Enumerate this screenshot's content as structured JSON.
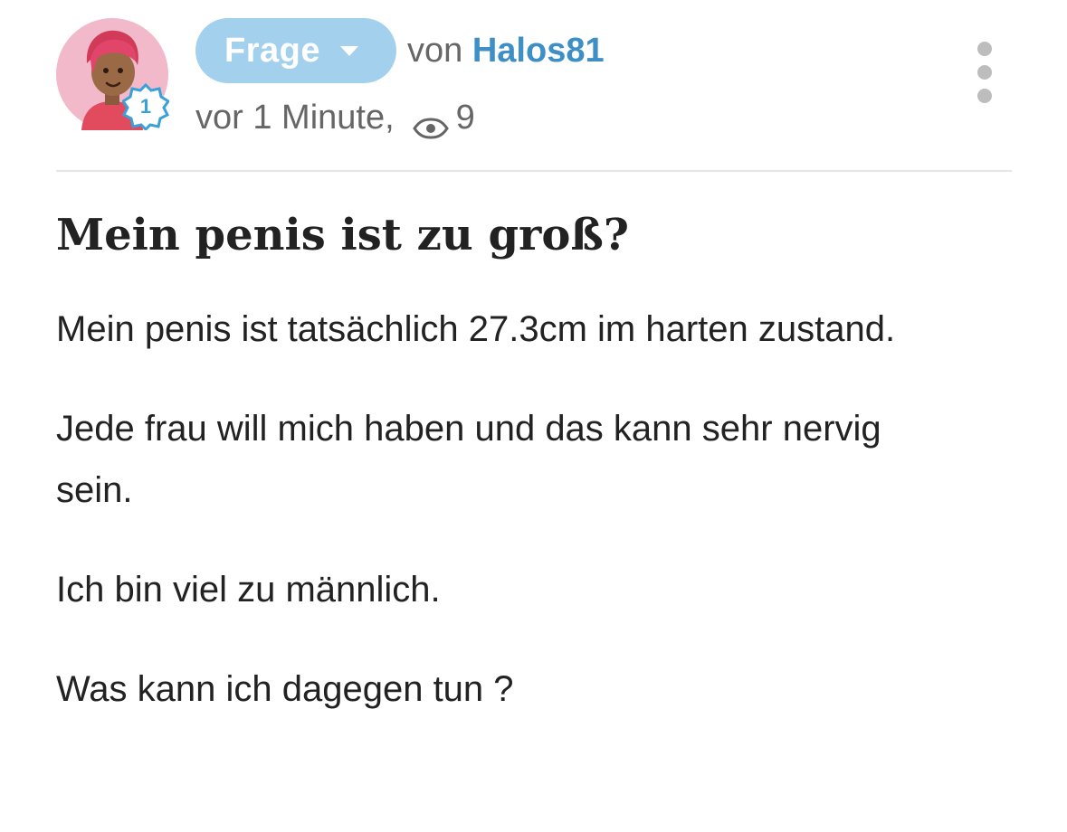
{
  "question": {
    "type_label": "Frage",
    "by_prefix": "von",
    "author": "Halos81",
    "time": "vor 1 Minute,",
    "views": "9",
    "author_level": "1",
    "title": "Mein penis ist zu groß?",
    "paragraphs": [
      "Mein penis ist tatsächlich 27.3cm im harten zustand.",
      "Jede frau will mich haben und das kann sehr nervig sein.",
      "Ich bin viel zu männlich.",
      "Was kann ich dagegen tun ?"
    ]
  },
  "icons": {
    "type_dropdown": "chevron-down-icon",
    "views": "eye-icon",
    "menu": "more-vertical-icon",
    "level_badge": "level-badge-icon"
  },
  "colors": {
    "pill_background": "#a3d0ec",
    "author_link": "#3d8fc6",
    "meta_text": "#666666",
    "body_text": "#222222",
    "avatar_background": "#f1b9c9",
    "badge_accent": "#3aa0d8"
  }
}
